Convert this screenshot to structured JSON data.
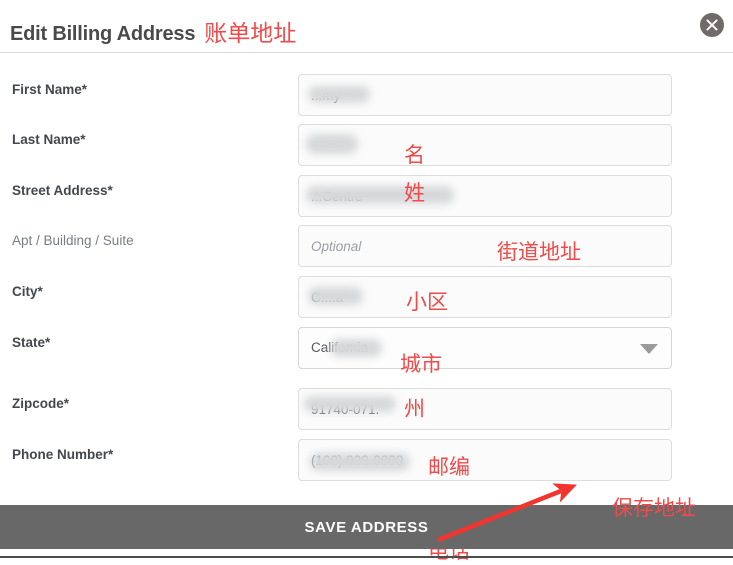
{
  "header": {
    "title": "Edit Billing Address",
    "title_annotation": "账单地址",
    "close_icon": "close-icon"
  },
  "form": {
    "fields": [
      {
        "label": "First Name",
        "required": true,
        "required_mark": "*",
        "value": "...my",
        "placeholder": "",
        "annotation": "名",
        "type": "text"
      },
      {
        "label": "Last Name",
        "required": true,
        "required_mark": "*",
        "value": "",
        "placeholder": "",
        "annotation": "姓",
        "type": "text"
      },
      {
        "label": "Street Address",
        "required": true,
        "required_mark": "*",
        "value": "...Centre",
        "placeholder": "",
        "annotation": "街道地址",
        "type": "text"
      },
      {
        "label": "Apt / Building / Suite",
        "required": false,
        "required_mark": "",
        "value": "",
        "placeholder": "Optional",
        "annotation": "小区",
        "type": "text"
      },
      {
        "label": "City",
        "required": true,
        "required_mark": "*",
        "value": "C....a",
        "placeholder": "",
        "annotation": "城市",
        "type": "text"
      },
      {
        "label": "State",
        "required": true,
        "required_mark": "*",
        "value": "California",
        "placeholder": "",
        "annotation": "州",
        "type": "select",
        "dropdown_icon": "chevron-down-icon"
      },
      {
        "label": "Zipcode",
        "required": true,
        "required_mark": "*",
        "value": "91740-071.",
        "placeholder": "",
        "annotation": "邮编",
        "type": "text"
      },
      {
        "label": "Phone Number",
        "required": true,
        "required_mark": "*",
        "value": "(100) 000-0000",
        "placeholder": "",
        "annotation": "电话",
        "type": "text"
      }
    ]
  },
  "footer": {
    "save_label": "SAVE ADDRESS",
    "save_annotation": "保存地址",
    "arrow_icon": "red-arrow-pointer"
  },
  "colors": {
    "annotation_red": "#f04a4a",
    "save_bar_gray": "#686868",
    "label_gray": "#43484d",
    "close_gray": "#6e6b68"
  }
}
